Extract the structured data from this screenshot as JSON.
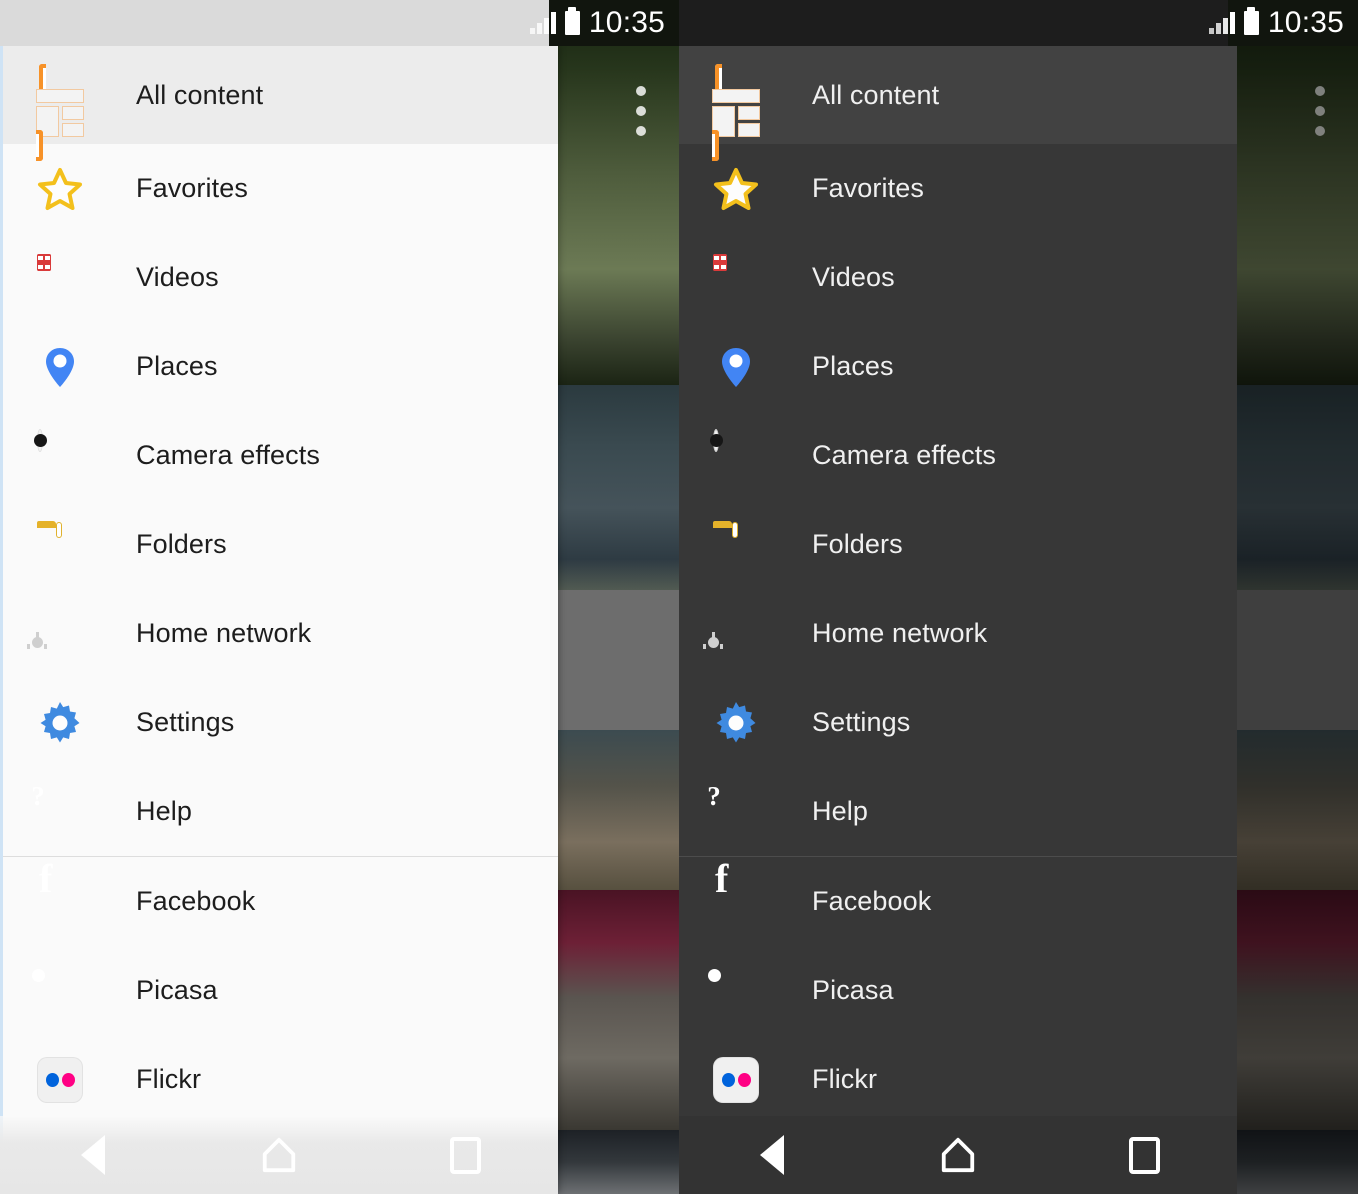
{
  "app": {
    "title": "Gallery navigation drawer",
    "panels": [
      {
        "id": "light-theme",
        "theme": "light"
      },
      {
        "id": "dark-theme",
        "theme": "dark"
      }
    ]
  },
  "status_bar": {
    "time": "10:35",
    "signal_icon": "signal-bars-icon",
    "battery_icon": "battery-icon",
    "signal_bars": 4,
    "battery_level_full": true
  },
  "drawer": {
    "selected_item": "All content",
    "groups": [
      {
        "id": "primary",
        "items": [
          {
            "label": "All content",
            "icon": "all-content-icon",
            "selected": true
          },
          {
            "label": "Favorites",
            "icon": "star-icon",
            "selected": false
          },
          {
            "label": "Videos",
            "icon": "film-icon",
            "selected": false
          },
          {
            "label": "Places",
            "icon": "map-pin-icon",
            "selected": false
          },
          {
            "label": "Camera effects",
            "icon": "color-wheel-icon",
            "selected": false
          },
          {
            "label": "Folders",
            "icon": "folder-icon",
            "selected": false
          },
          {
            "label": "Home network",
            "icon": "network-server-icon",
            "selected": false
          },
          {
            "label": "Settings",
            "icon": "gear-icon",
            "selected": false
          },
          {
            "label": "Help",
            "icon": "help-bubble-icon",
            "selected": false
          }
        ]
      },
      {
        "id": "accounts",
        "items": [
          {
            "label": "Facebook",
            "icon": "facebook-icon",
            "selected": false
          },
          {
            "label": "Picasa",
            "icon": "picasa-icon",
            "selected": false
          },
          {
            "label": "Flickr",
            "icon": "flickr-icon",
            "selected": false
          }
        ]
      }
    ]
  },
  "nav_bar": {
    "buttons": [
      {
        "name": "back",
        "icon": "back-triangle-icon"
      },
      {
        "name": "home",
        "icon": "home-pentagon-icon"
      },
      {
        "name": "recent",
        "icon": "recents-square-icon"
      }
    ]
  },
  "colors": {
    "accent_orange": "#f79228",
    "star_yellow": "#f5c518",
    "video_red": "#d93a3a",
    "pin_blue": "#4285f4",
    "folder_yellow": "#f0c23a",
    "network_green": "#7cb342",
    "gear_blue": "#3f8ae0",
    "help_blue": "#3f8ae0",
    "facebook_blue": "#3b5998",
    "flickr_blue": "#0063dc",
    "flickr_pink": "#ff0084",
    "light_bg": "#fafafa",
    "light_selected": "#ececec",
    "light_statusbar": "#dadada",
    "dark_bg": "#373737",
    "dark_selected": "#424242",
    "dark_statusbar": "#1d1d1d",
    "dark_navbar": "#333333"
  },
  "background_thumbnails": [
    {
      "name": "trees-lake-photo"
    },
    {
      "name": "water-shore-photo"
    },
    {
      "name": "gray-placeholder"
    },
    {
      "name": "rocks-people-photo"
    },
    {
      "name": "purple-sky-photo"
    },
    {
      "name": "dusk-field-photo"
    }
  ]
}
